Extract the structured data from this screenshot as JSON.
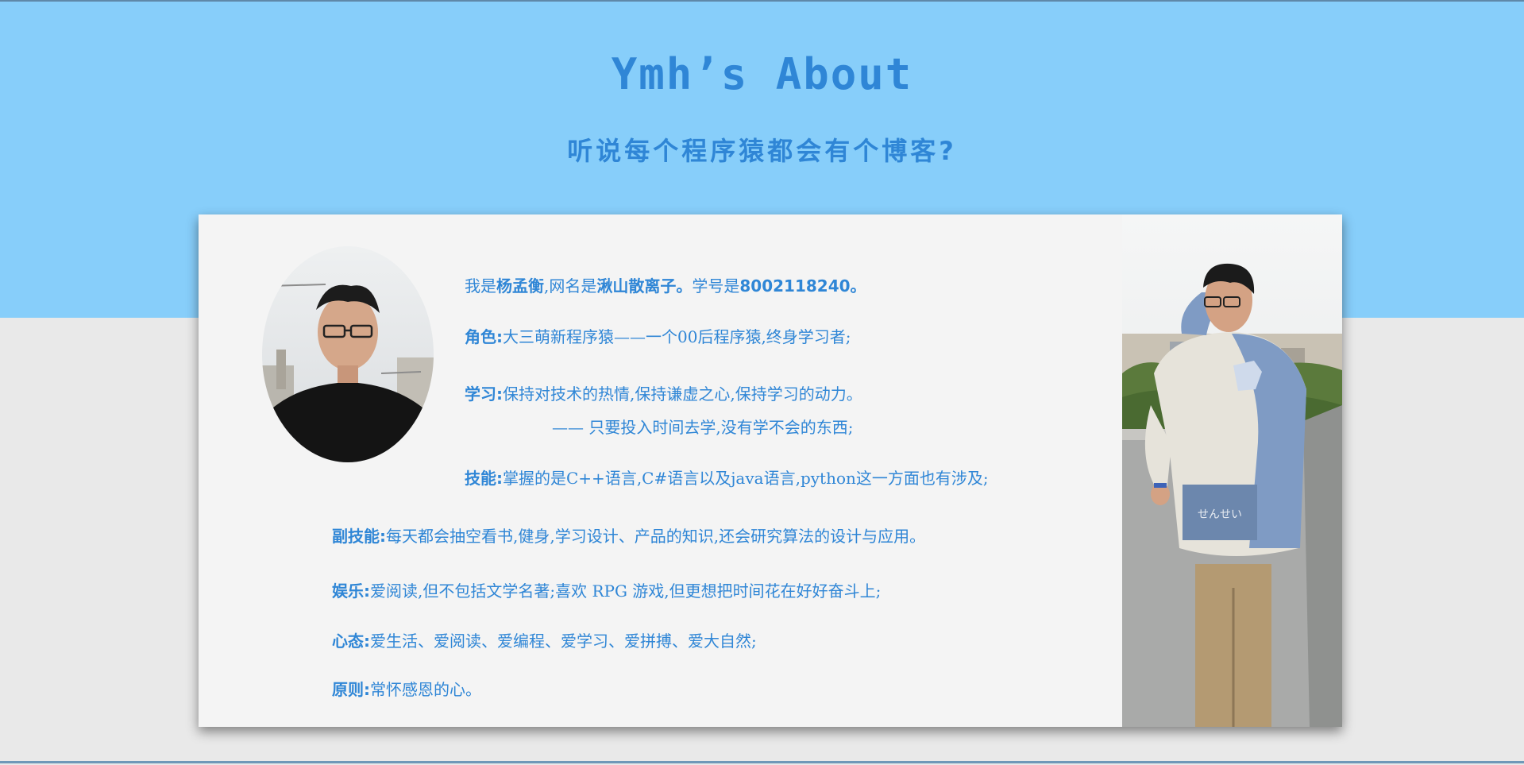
{
  "header": {
    "title": "Ymh’s About",
    "subtitle": "听说每个程序猿都会有个博客?"
  },
  "profile": {
    "intro_prefix": "我是",
    "name": "杨孟衡",
    "nick_prefix": ",网名是",
    "nickname": "湫山散离子。",
    "id_prefix": "学号是",
    "student_id": "8002118240。"
  },
  "sections": {
    "role": {
      "label": "角色:",
      "text": "大三萌新程序猿——一个00后程序猿,终身学习者;"
    },
    "study": {
      "label": "学习:",
      "text": "保持对技术的热情,保持谦虚之心,保持学习的动力。",
      "quote": "—— 只要投入时间去学,没有学不会的东西;"
    },
    "skills": {
      "label": "技能:",
      "text": "掌握的是C++语言,C#语言以及java语言,python这一方面也有涉及;"
    },
    "side_skills": {
      "label": "副技能:",
      "text": "每天都会抽空看书,健身,学习设计、产品的知识,还会研究算法的设计与应用。"
    },
    "hobby": {
      "label": "娱乐:",
      "text": "爱阅读,但不包括文学名著;喜欢 RPG 游戏,但更想把时间花在好好奋斗上;"
    },
    "mindset": {
      "label": "心态:",
      "text": "爱生活、爱阅读、爱编程、爱学习、爱拼搏、爱大自然;"
    },
    "principle": {
      "label": "原则:",
      "text": "常怀感恩的心。"
    }
  },
  "photo": {
    "hoodie_text": "せんせい"
  },
  "colors": {
    "accent": "#2f86d6",
    "hero_bg": "#87cefa",
    "page_bg": "#e9e9e9",
    "card_bg": "#f4f4f4"
  }
}
